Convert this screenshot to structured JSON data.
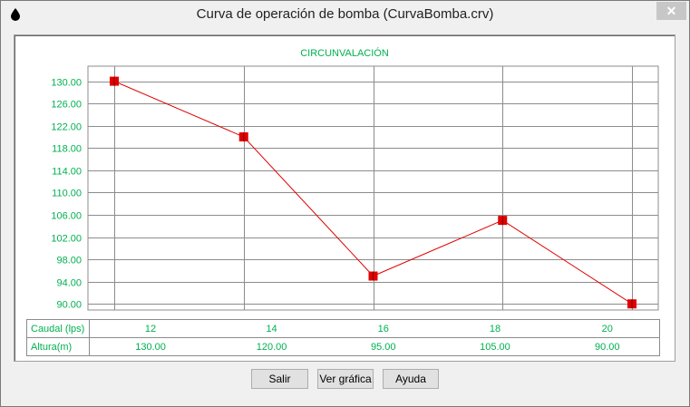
{
  "window": {
    "title": "Curva de operación de bomba (CurvaBomba.crv)",
    "close_glyph": "✕"
  },
  "buttons": {
    "salir": "Salir",
    "ver_grafica": "Ver gráfica",
    "ayuda": "Ayuda"
  },
  "table": {
    "row1_label": "Caudal (lps)",
    "row2_label": "Altura(m)",
    "caudal": [
      "12",
      "14",
      "16",
      "18",
      "20"
    ],
    "altura": [
      "130.00",
      "120.00",
      "95.00",
      "105.00",
      "90.00"
    ]
  },
  "chart_data": {
    "type": "line",
    "title": "CIRCUNVALACIÓN",
    "x": [
      12,
      14,
      16,
      18,
      20
    ],
    "series": [
      {
        "values": [
          130,
          120,
          95,
          105,
          90
        ]
      }
    ],
    "y_ticks": [
      "130.00",
      "126.00",
      "122.00",
      "118.00",
      "114.00",
      "110.00",
      "106.00",
      "102.00",
      "98.00",
      "94.00",
      "90.00"
    ],
    "ylim": [
      88.9,
      132.7
    ],
    "xlim": [
      12,
      20
    ],
    "grid": true,
    "line_color": "#e00000",
    "marker_color": "#e00000",
    "label_color": "#00b050"
  }
}
